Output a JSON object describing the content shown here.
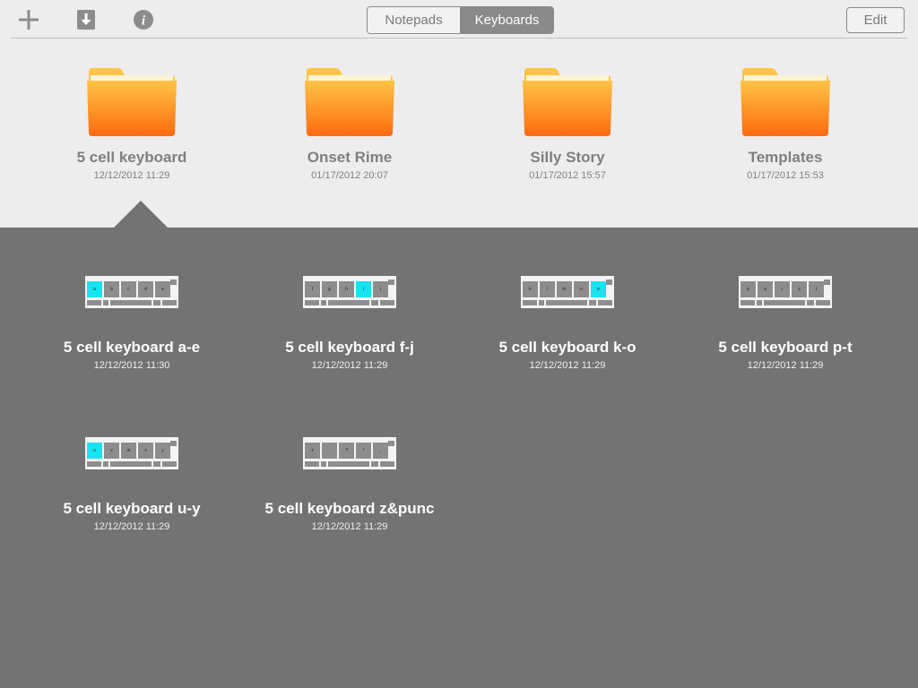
{
  "toolbar": {
    "segments": {
      "notepads": "Notepads",
      "keyboards": "Keyboards",
      "selected": "Keyboards"
    },
    "edit_label": "Edit",
    "icons": [
      "plus-icon",
      "download-icon",
      "info-icon"
    ],
    "info_glyph": "i"
  },
  "folders": [
    {
      "name": "5 cell keyboard",
      "date": "12/12/2012 11:29",
      "selected": true
    },
    {
      "name": "Onset Rime",
      "date": "01/17/2012 20:07"
    },
    {
      "name": "Silly Story",
      "date": "01/17/2012 15:57"
    },
    {
      "name": "Templates",
      "date": "01/17/2012 15:53"
    }
  ],
  "keyboards": [
    {
      "name": "5 cell keyboard a-e",
      "date": "12/12/2012 11:30",
      "keys": [
        "a",
        "b",
        "c",
        "d",
        "e"
      ],
      "highlight": [
        0
      ]
    },
    {
      "name": "5 cell keyboard f-j",
      "date": "12/12/2012 11:29",
      "keys": [
        "f",
        "g",
        "h",
        "i",
        "j"
      ],
      "highlight": [
        3
      ]
    },
    {
      "name": "5 cell keyboard k-o",
      "date": "12/12/2012 11:29",
      "keys": [
        "k",
        "l",
        "m",
        "n",
        "o"
      ],
      "highlight": [
        4
      ]
    },
    {
      "name": "5 cell keyboard p-t",
      "date": "12/12/2012 11:29",
      "keys": [
        "p",
        "q",
        "r",
        "s",
        "t"
      ],
      "highlight": []
    },
    {
      "name": "5 cell keyboard u-y",
      "date": "12/12/2012 11:29",
      "keys": [
        "u",
        "v",
        "w",
        "x",
        "y"
      ],
      "highlight": [
        0
      ]
    },
    {
      "name": "5 cell keyboard z&punc",
      "date": "12/12/2012 11:29",
      "keys": [
        "z",
        ".",
        "?",
        "!",
        ","
      ],
      "highlight": []
    }
  ],
  "colors": {
    "panel": "#737373",
    "folder_top": "#ffc445",
    "folder_bottom": "#ff6a10",
    "highlight_key": "#19e3ee"
  }
}
